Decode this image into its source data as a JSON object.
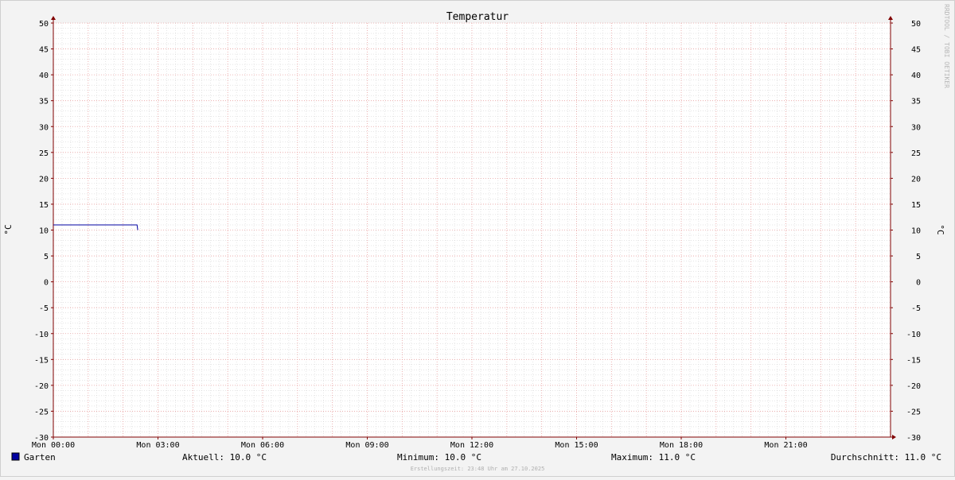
{
  "chart_data": {
    "type": "line",
    "title": "Temperatur",
    "ylabel": "°C",
    "ylabel_right": "°C",
    "ylim": [
      -30,
      50
    ],
    "y_major_step": 5,
    "xlim_hours": [
      0,
      24
    ],
    "x_ticks": [
      {
        "hour": 0,
        "label": "Mon 00:00"
      },
      {
        "hour": 3,
        "label": "Mon 03:00"
      },
      {
        "hour": 6,
        "label": "Mon 06:00"
      },
      {
        "hour": 9,
        "label": "Mon 09:00"
      },
      {
        "hour": 12,
        "label": "Mon 12:00"
      },
      {
        "hour": 15,
        "label": "Mon 15:00"
      },
      {
        "hour": 18,
        "label": "Mon 18:00"
      },
      {
        "hour": 21,
        "label": "Mon 21:00"
      }
    ],
    "grid": true,
    "series": [
      {
        "name": "Garten",
        "color": "#0000a0",
        "points": [
          {
            "x": 0,
            "y": 11.0
          },
          {
            "x": 2.4,
            "y": 11.0
          },
          {
            "x": 2.42,
            "y": 10.0
          }
        ]
      }
    ],
    "legend": {
      "aktuell": "Aktuell: 10.0 °C",
      "minimum": "Minimum: 10.0 °C",
      "maximum": "Maximum: 11.0 °C",
      "durchschnitt": "Durchschnitt: 11.0 °C"
    },
    "footer": "Erstellungszeit: 23:48 Uhr am 27.10.2025",
    "watermark": "RRDTOOL / TOBI OETIKER",
    "colors": {
      "major_grid": "#e8a0a0",
      "minor_grid": "#cccccc",
      "axis": "#800000"
    }
  }
}
